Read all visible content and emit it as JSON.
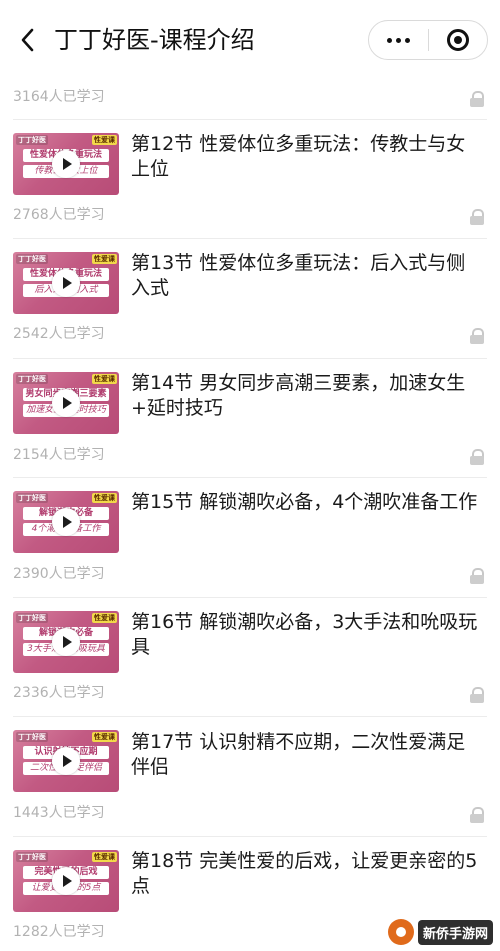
{
  "nav": {
    "title": "丁丁好医-课程介绍",
    "back_icon": "chevron-left-icon",
    "more_icon": "more-dots-icon",
    "close_icon": "record-circle-icon"
  },
  "top_item": {
    "learners": "3164人已学习"
  },
  "lessons": [
    {
      "title": "第12节 性爱体位多重玩法：传教士与女上位",
      "learners": "2768人已学习",
      "thumb": {
        "brand": "丁丁好医",
        "tag": "性爱课",
        "line1": "性爱体位多重玩法",
        "line2": "传教士与女上位"
      }
    },
    {
      "title": "第13节 性爱体位多重玩法：后入式与侧入式",
      "learners": "2542人已学习",
      "thumb": {
        "brand": "丁丁好医",
        "tag": "性爱课",
        "line1": "性爱体位多重玩法",
        "line2": "后入式与侧入式"
      }
    },
    {
      "title": "第14节 男女同步高潮三要素，加速女生+延时技巧",
      "learners": "2154人已学习",
      "thumb": {
        "brand": "丁丁好医",
        "tag": "性爱课",
        "line1": "男女同步高潮三要素",
        "line2": "加速女生+延时技巧"
      }
    },
    {
      "title": "第15节 解锁潮吹必备，4个潮吹准备工作",
      "learners": "2390人已学习",
      "thumb": {
        "brand": "丁丁好医",
        "tag": "性爱课",
        "line1": "解锁潮吹必备",
        "line2": "4个潮吹准备工作"
      }
    },
    {
      "title": "第16节 解锁潮吹必备，3大手法和吮吸玩具",
      "learners": "2336人已学习",
      "thumb": {
        "brand": "丁丁好医",
        "tag": "性爱课",
        "line1": "解锁潮吹必备",
        "line2": "3大手法和吮吸玩具"
      }
    },
    {
      "title": "第17节 认识射精不应期，二次性爱满足伴侣",
      "learners": "1443人已学习",
      "thumb": {
        "brand": "丁丁好医",
        "tag": "性爱课",
        "line1": "认识射精不应期",
        "line2": "二次性爱满足伴侣"
      }
    },
    {
      "title": "第18节 完美性爱的后戏，让爱更亲密的5点",
      "learners": "1282人已学习",
      "thumb": {
        "brand": "丁丁好医",
        "tag": "性爱课",
        "line1": "完美性爱的后戏",
        "line2": "让爱更亲密的5点"
      }
    }
  ],
  "watermark": {
    "text": "新侨手游网"
  },
  "colors": {
    "thumb_pink": "#c25a83",
    "count_gray": "#b2b2b2",
    "lock_gray": "#cdcdcd"
  }
}
